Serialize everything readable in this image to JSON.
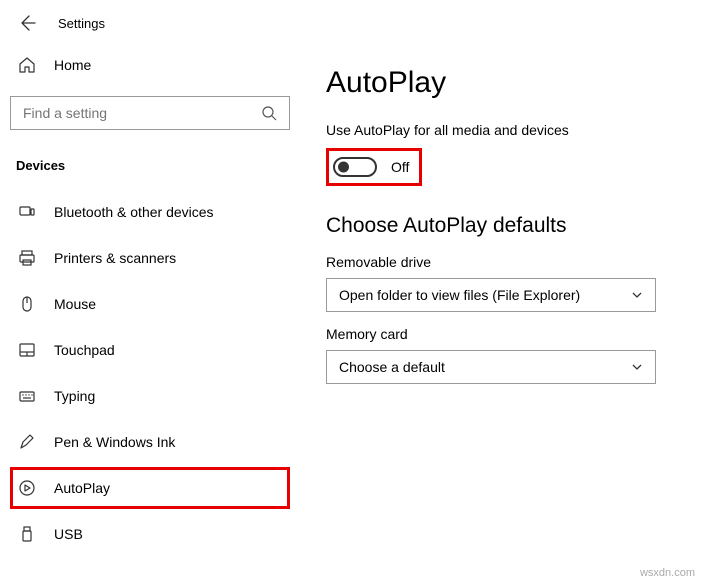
{
  "header": {
    "title": "Settings"
  },
  "sidebar": {
    "home_label": "Home",
    "search_placeholder": "Find a setting",
    "section_title": "Devices",
    "items": [
      {
        "label": "Bluetooth & other devices"
      },
      {
        "label": "Printers & scanners"
      },
      {
        "label": "Mouse"
      },
      {
        "label": "Touchpad"
      },
      {
        "label": "Typing"
      },
      {
        "label": "Pen & Windows Ink"
      },
      {
        "label": "AutoPlay"
      },
      {
        "label": "USB"
      }
    ]
  },
  "main": {
    "title": "AutoPlay",
    "use_for_all_label": "Use AutoPlay for all media and devices",
    "toggle_state": "Off",
    "defaults_heading": "Choose AutoPlay defaults",
    "removable_label": "Removable drive",
    "removable_value": "Open folder to view files (File Explorer)",
    "memory_label": "Memory card",
    "memory_value": "Choose a default"
  },
  "watermark": "wsxdn.com"
}
